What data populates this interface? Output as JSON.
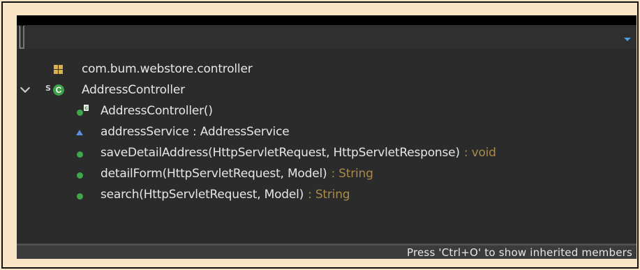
{
  "filter": {
    "value": "",
    "placeholder": ""
  },
  "tree": {
    "package": {
      "label": "com.bum.webstore.controller",
      "icon": "package-icon"
    },
    "class": {
      "label": "AddressController",
      "icon": "class-icon",
      "expanded": true,
      "members": [
        {
          "name": "AddressController()",
          "return": "",
          "icon": "constructor-icon"
        },
        {
          "name": "addressService : AddressService",
          "return": "",
          "icon": "protected-field-icon"
        },
        {
          "name": "saveDetailAddress(HttpServletRequest, HttpServletResponse)",
          "return": " : void",
          "icon": "public-method-icon"
        },
        {
          "name": "detailForm(HttpServletRequest, Model)",
          "return": " : String",
          "icon": "public-method-icon"
        },
        {
          "name": "search(HttpServletRequest, Model)",
          "return": " : String",
          "icon": "public-method-icon"
        }
      ]
    }
  },
  "status": {
    "text": "Press 'Ctrl+O' to show inherited members"
  },
  "colors": {
    "background": "#f9e4c6",
    "popup": "#2b2b2b",
    "return_type": "#a98a4a",
    "method_dot": "#3ea64b",
    "field_triangle": "#5a8fe0"
  }
}
